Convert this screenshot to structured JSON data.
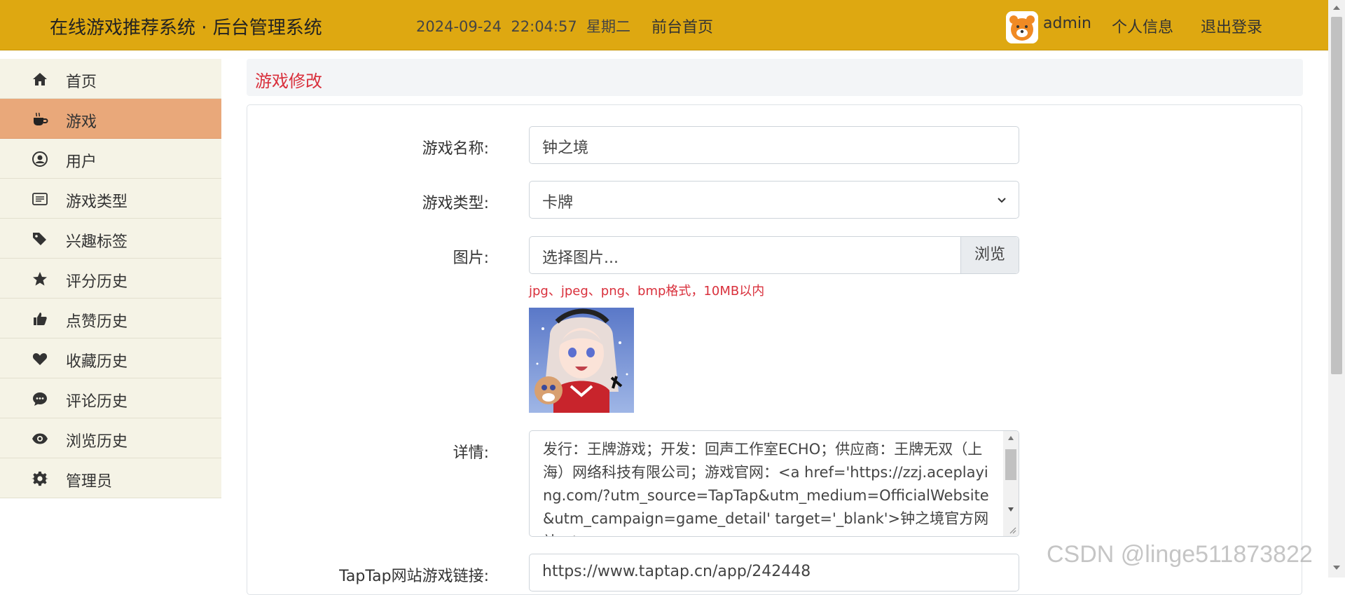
{
  "header": {
    "title": "在线游戏推荐系统 · 后台管理系统",
    "datetime": "2024-09-24  22:04:57  星期二",
    "front_link": "前台首页",
    "username": "admin",
    "profile_link": "个人信息",
    "logout_link": "退出登录",
    "bg_color": "#dea811"
  },
  "sidebar": {
    "items": [
      {
        "label": "首页",
        "icon": "home-icon"
      },
      {
        "label": "游戏",
        "icon": "coffee-icon",
        "active": true
      },
      {
        "label": "用户",
        "icon": "user-circle-icon"
      },
      {
        "label": "游戏类型",
        "icon": "list-icon"
      },
      {
        "label": "兴趣标签",
        "icon": "tags-icon"
      },
      {
        "label": "评分历史",
        "icon": "star-icon"
      },
      {
        "label": "点赞历史",
        "icon": "thumbs-up-icon"
      },
      {
        "label": "收藏历史",
        "icon": "heart-icon"
      },
      {
        "label": "评论历史",
        "icon": "comment-icon"
      },
      {
        "label": "浏览历史",
        "icon": "eye-icon"
      },
      {
        "label": "管理员",
        "icon": "gear-icon"
      }
    ],
    "active_color": "#e9a87a"
  },
  "main": {
    "heading": "游戏修改",
    "form": {
      "name_label": "游戏名称:",
      "name_value": "钟之境",
      "type_label": "游戏类型:",
      "type_value": "卡牌",
      "image_label": "图片:",
      "image_placeholder": "选择图片...",
      "browse_label": "浏览",
      "image_hint": "jpg、jpeg、png、bmp格式，10MB以内",
      "detail_label": "详情:",
      "detail_value": "发行：王牌游戏；开发：回声工作室ECHO；供应商：王牌无双（上海）网络科技有限公司；游戏官网：<a href='https://zzj.aceplaying.com/?utm_source=TapTap&utm_medium=OfficialWebsite&utm_campaign=game_detail' target='_blank'>钟之境官方网站</a>",
      "link_label": "TapTap网站游戏链接:",
      "link_value": "https://www.taptap.cn/app/242448"
    }
  },
  "watermark": "CSDN @linge511873822"
}
